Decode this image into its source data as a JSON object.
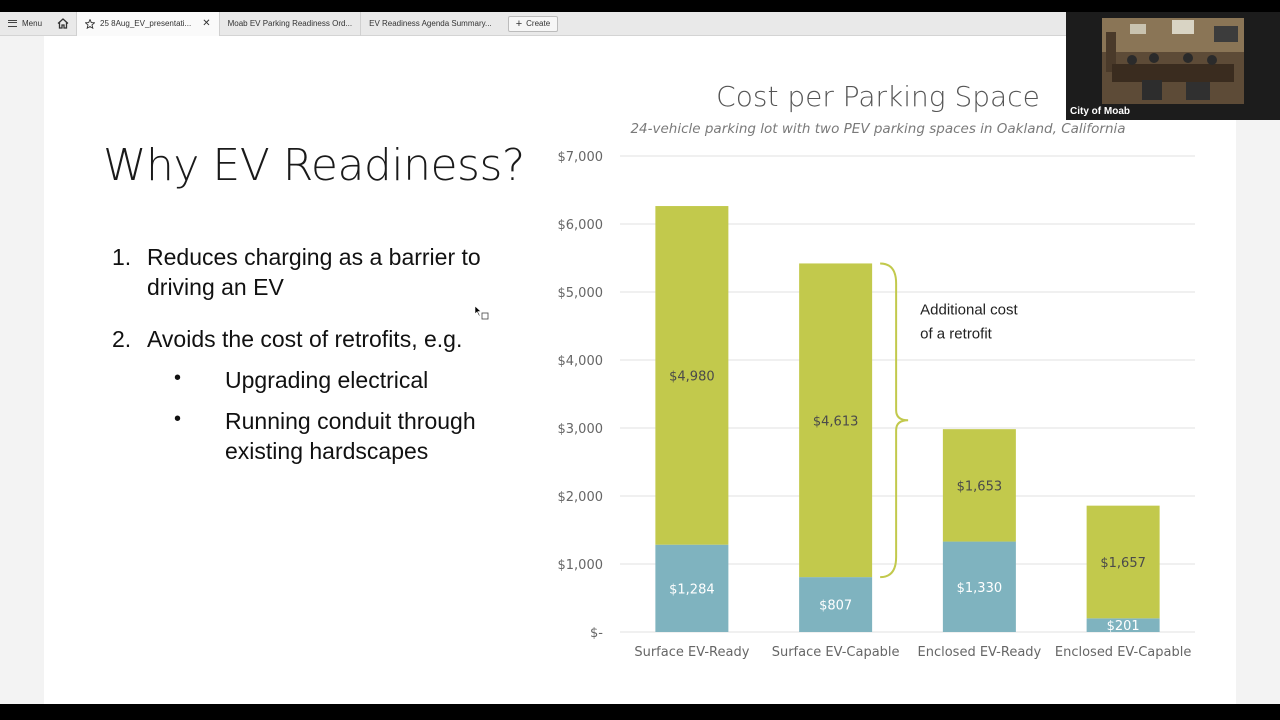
{
  "tabs": {
    "menu_label": "Menu",
    "items": [
      {
        "label": "25 8Aug_EV_presentati...",
        "active": true
      },
      {
        "label": "Moab EV Parking Readiness Ord...",
        "active": false
      },
      {
        "label": "EV Readiness Agenda Summary...",
        "active": false
      }
    ],
    "create_label": "Create"
  },
  "webcam": {
    "label": "City of Moab"
  },
  "slide": {
    "title": "Why EV Readiness?",
    "points": [
      {
        "number": "1.",
        "text": "Reduces charging as a barrier to driving an EV"
      },
      {
        "number": "2.",
        "text": "Avoids the cost of retrofits, e.g."
      }
    ],
    "sub_points": [
      "Upgrading electrical",
      "Running conduit through existing hardscapes"
    ],
    "bullet_char": "•"
  },
  "chart_data": {
    "type": "bar",
    "stacked": true,
    "title": "Cost per Parking Space",
    "subtitle": "24-vehicle parking lot with two PEV parking spaces in Oakland, California",
    "categories": [
      "Surface EV-Ready",
      "Surface EV-Capable",
      "Enclosed EV-Ready",
      "Enclosed EV-Capable"
    ],
    "series": [
      {
        "values": [
          1284,
          807,
          1330,
          201
        ],
        "labels": [
          "$1,284",
          "$807",
          "$1,330",
          "$201"
        ],
        "color": "#7fb3bf"
      },
      {
        "values": [
          4980,
          4613,
          1653,
          1657
        ],
        "labels": [
          "$4,980",
          "$4,613",
          "$1,653",
          "$1,657"
        ],
        "color": "#c2c94c"
      }
    ],
    "ylim": [
      0,
      7000
    ],
    "yticks": [
      0,
      1000,
      2000,
      3000,
      4000,
      5000,
      6000,
      7000
    ],
    "ytick_labels": [
      "$-",
      "$1,000",
      "$2,000",
      "$3,000",
      "$4,000",
      "$5,000",
      "$6,000",
      "$7,000"
    ],
    "grid": true,
    "annotation": {
      "text_line1": "Additional cost",
      "text_line2": "of a retrofit",
      "bracket_category": "Surface EV-Capable"
    },
    "colors": {
      "grid": "#e2e2e2",
      "axis_text": "#666666",
      "label_light": "#ffffff",
      "label_dark": "#4a4a4a",
      "bracket": "#c2c94c"
    }
  }
}
